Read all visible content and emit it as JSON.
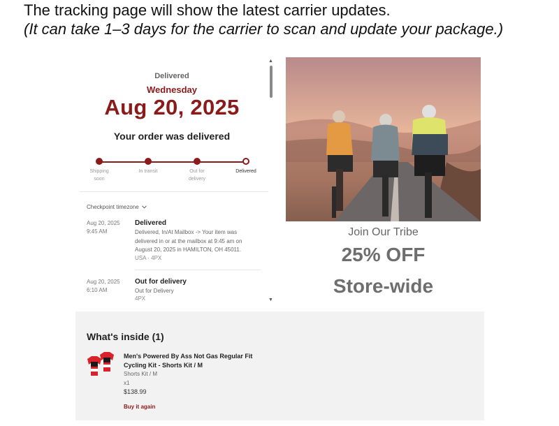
{
  "intro": {
    "line1": "The tracking page will show the latest carrier updates.",
    "line2": "(It can take 1–3 days for the carrier to scan and update your package.)"
  },
  "tracking": {
    "status": "Delivered",
    "weekday": "Wednesday",
    "date": "Aug 20, 2025",
    "headline": "Your order was delivered",
    "steps": [
      {
        "line1": "Shipping",
        "line2": "soon"
      },
      {
        "line1": "In transit",
        "line2": ""
      },
      {
        "line1": "Out for",
        "line2": "delivery"
      },
      {
        "line1": "Delivered",
        "line2": ""
      }
    ],
    "timezone_label": "Checkpoint timezone",
    "events": [
      {
        "date": "Aug 20, 2025",
        "time": "9:45 AM",
        "title": "Delivered",
        "desc_lines": [
          "Delivered, In/At Mailbox -> Your item was",
          "delivered in or at the mailbox at 9:45 am on",
          "August 20, 2025 in HAMILTON, OH 45011."
        ],
        "sub": "USA · 4PX"
      },
      {
        "date": "Aug 20, 2025",
        "time": "6:10 AM",
        "title": "Out for delivery",
        "desc_lines": [
          "Out for Delivery"
        ],
        "sub": "4PX"
      }
    ]
  },
  "promo": {
    "tagline": "Join Our Tribe",
    "discount": "25% OFF",
    "scope": "Store-wide"
  },
  "inside": {
    "title": "What's inside (1)",
    "product": {
      "name_line1": "Men's Powered By Ass Not Gas Regular Fit",
      "name_line2": "Cycling Kit - Shorts Kit / M",
      "variant": "Shorts Kit / M",
      "qty": "x1",
      "price": "$138.99",
      "action": "Buy it again"
    }
  },
  "colors": {
    "accent": "#8b1a1a",
    "promo_text": "#6e6e6e",
    "panel_bg": "#f2f2f2"
  }
}
